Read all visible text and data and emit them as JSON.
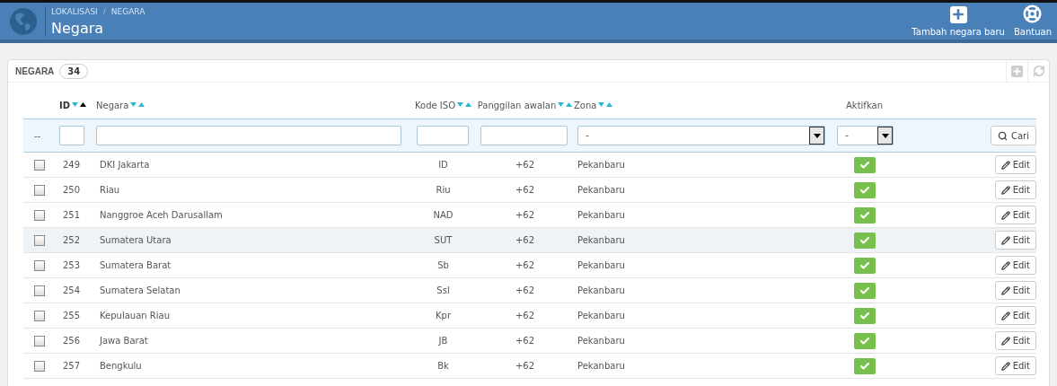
{
  "header": {
    "breadcrumb": [
      "LOKALISASI",
      "NEGARA"
    ],
    "breadcrumb_separator": "/",
    "title": "Negara",
    "actions": [
      {
        "kind": "add",
        "label": "Tambah negara baru"
      },
      {
        "kind": "help",
        "label": "Bantuan"
      }
    ]
  },
  "panel": {
    "title": "NEGARA",
    "count": "34"
  },
  "columns": [
    {
      "label": "ID",
      "sorted": true
    },
    {
      "label": "Negara",
      "sorted": false
    },
    {
      "label": "Kode ISO",
      "sorted": false
    },
    {
      "label": "Panggilan awalan",
      "sorted": false
    },
    {
      "label": "Zona",
      "sorted": false
    },
    {
      "label": "Aktifkan"
    }
  ],
  "filters": {
    "reset": "--",
    "zone": "-",
    "active": "-",
    "search_button": "Cari"
  },
  "rows": [
    {
      "id": "249",
      "name": "DKI Jakarta",
      "iso": "ID",
      "prefix": "+62",
      "zone": "Pekanbaru",
      "active": true,
      "checked": false,
      "selected": false,
      "action": "Edit"
    },
    {
      "id": "250",
      "name": "Riau",
      "iso": "Riu",
      "prefix": "+62",
      "zone": "Pekanbaru",
      "active": true,
      "checked": false,
      "selected": false,
      "action": "Edit"
    },
    {
      "id": "251",
      "name": "Nanggroe Aceh Darusallam",
      "iso": "NAD",
      "prefix": "+62",
      "zone": "Pekanbaru",
      "active": true,
      "checked": false,
      "selected": false,
      "action": "Edit"
    },
    {
      "id": "252",
      "name": "Sumatera Utara",
      "iso": "SUT",
      "prefix": "+62",
      "zone": "Pekanbaru",
      "active": true,
      "checked": false,
      "selected": true,
      "action": "Edit"
    },
    {
      "id": "253",
      "name": "Sumatera Barat",
      "iso": "Sb",
      "prefix": "+62",
      "zone": "Pekanbaru",
      "active": true,
      "checked": false,
      "selected": false,
      "action": "Edit"
    },
    {
      "id": "254",
      "name": "Sumatera Selatan",
      "iso": "Ssl",
      "prefix": "+62",
      "zone": "Pekanbaru",
      "active": true,
      "checked": false,
      "selected": false,
      "action": "Edit"
    },
    {
      "id": "255",
      "name": "Kepulauan Riau",
      "iso": "Kpr",
      "prefix": "+62",
      "zone": "Pekanbaru",
      "active": true,
      "checked": false,
      "selected": false,
      "action": "Edit"
    },
    {
      "id": "256",
      "name": "Jawa Barat",
      "iso": "JB",
      "prefix": "+62",
      "zone": "Pekanbaru",
      "active": true,
      "checked": false,
      "selected": false,
      "action": "Edit"
    },
    {
      "id": "257",
      "name": "Bengkulu",
      "iso": "Bk",
      "prefix": "+62",
      "zone": "Pekanbaru",
      "active": true,
      "checked": false,
      "selected": false,
      "action": "Edit"
    }
  ]
}
